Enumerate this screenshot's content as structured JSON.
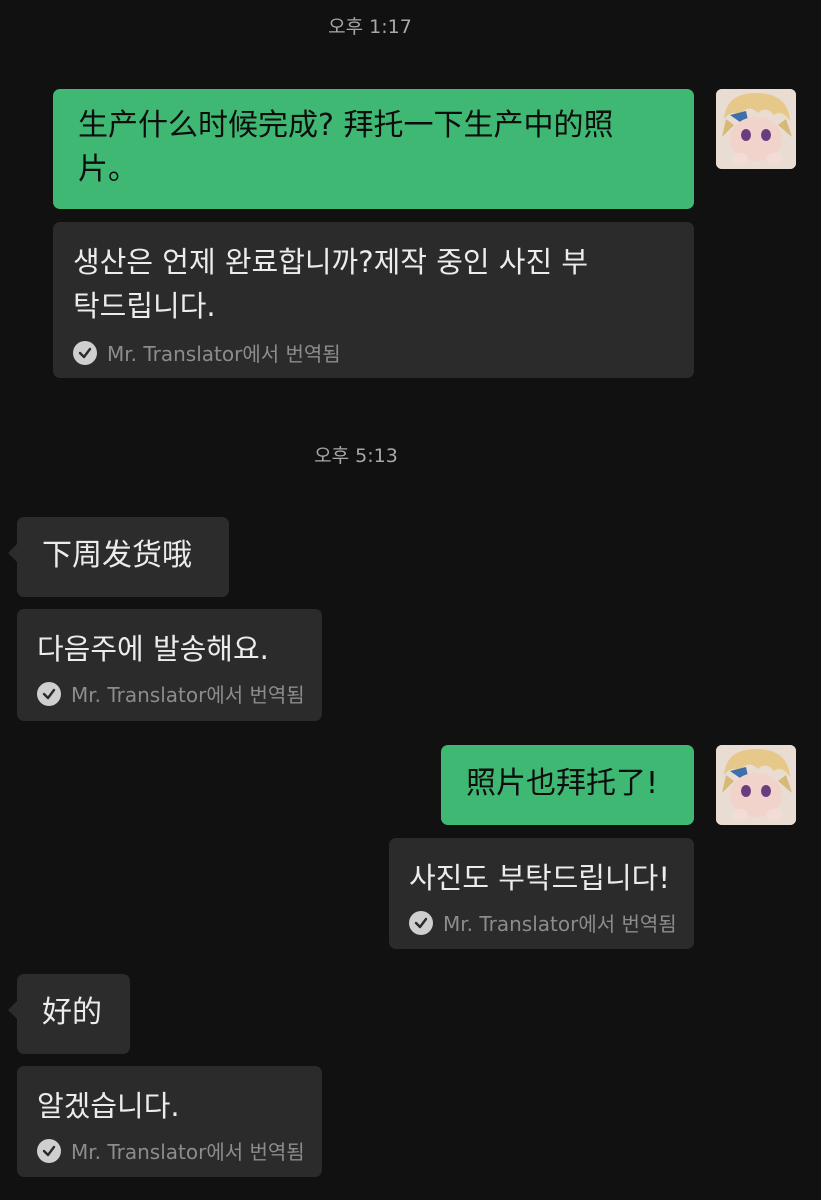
{
  "timestamps": [
    "오후 1:17",
    "오후 5:13"
  ],
  "messages": [
    {
      "sender": "me",
      "text": "生产什么时候完成? 拜托一下生产中的照片。",
      "translation": "생산은 언제 완료합니까?제작 중인 사진 부탁드립니다.",
      "translated_by": "Mr. Translator에서 번역됨"
    },
    {
      "sender": "other",
      "text": "下周发货哦",
      "translation": "다음주에 발송해요.",
      "translated_by": "Mr. Translator에서 번역됨"
    },
    {
      "sender": "me",
      "text": "照片也拜托了!",
      "translation": "사진도 부탁드립니다!",
      "translated_by": "Mr. Translator에서 번역됨"
    },
    {
      "sender": "other",
      "text": "好的",
      "translation": "알겠습니다.",
      "translated_by": "Mr. Translator에서 번역됨"
    }
  ],
  "colors": {
    "background": "#111111",
    "sent_bubble": "#3fb873",
    "dark_bubble": "#2c2c2c",
    "timestamp_text": "#a9a9a9",
    "translation_note": "#8c8c8c"
  }
}
